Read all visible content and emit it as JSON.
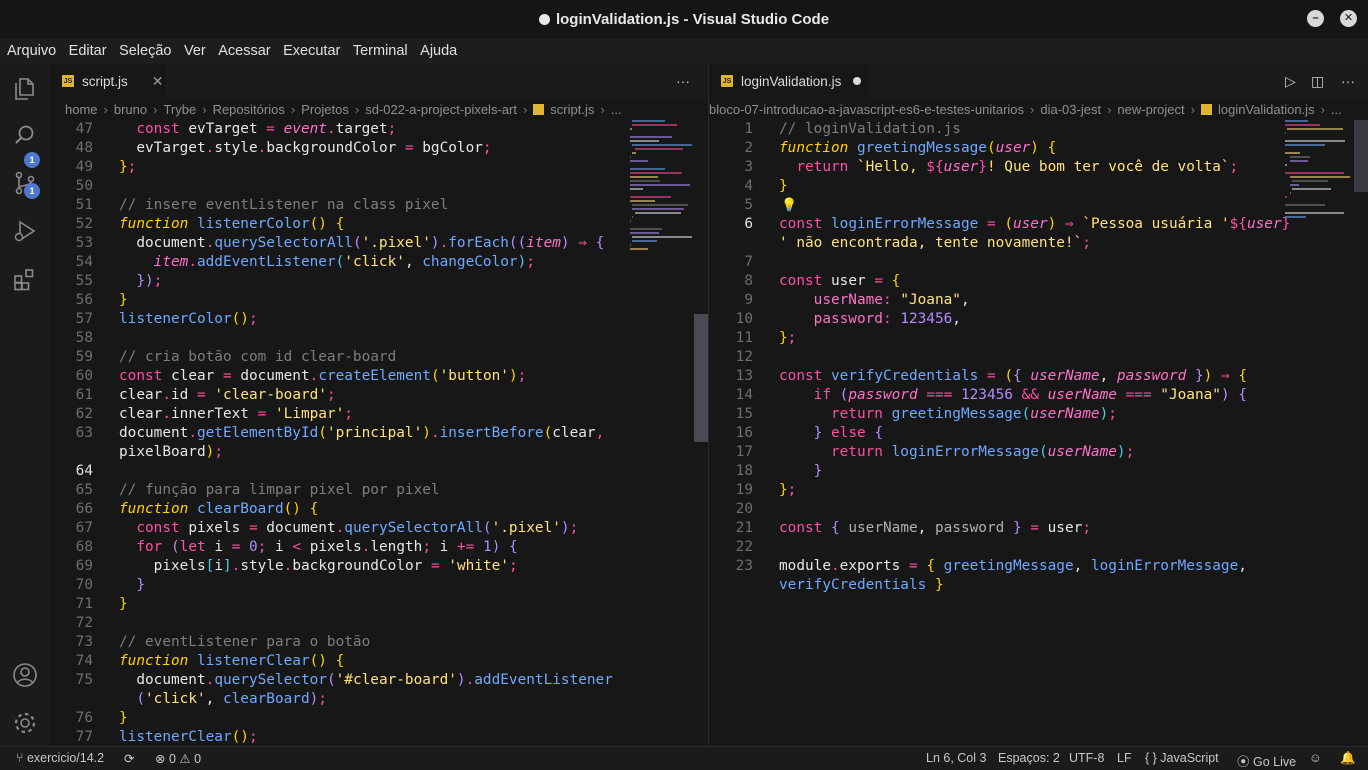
{
  "window": {
    "title": "loginValidation.js - Visual Studio Code"
  },
  "menu": [
    "Arquivo",
    "Editar",
    "Seleção",
    "Ver",
    "Acessar",
    "Executar",
    "Terminal",
    "Ajuda"
  ],
  "activity_bar": {
    "explorer_badge": "1",
    "source_control_badge": "1"
  },
  "left_editor": {
    "tab_label": "script.js",
    "breadcrumb": [
      "home",
      "bruno",
      "Trybe",
      "Repositórios",
      "Projetos",
      "sd-022-a-project-pixels-art",
      "script.js",
      "..."
    ],
    "lines": [
      {
        "n": "47",
        "html": "  <span class='k'>const</span> evTarget <span class='k'>=</span> <span class='i'>event</span><span class='k'>.</span><span class='v'>target</span><span class='k'>;</span>"
      },
      {
        "n": "48",
        "html": "  evTarget<span class='k'>.</span>style<span class='k'>.</span>backgroundColor <span class='k'>=</span> bgColor<span class='k'>;</span>"
      },
      {
        "n": "49",
        "html": "<span class='b'>}</span><span class='k'>;</span>"
      },
      {
        "n": "50",
        "html": ""
      },
      {
        "n": "51",
        "html": "<span class='c'>// insere eventListener na class pixel</span>"
      },
      {
        "n": "52",
        "html": "<span class='i' style='color:#ffd200'>function</span> <span class='f'>listenerColor</span><span class='b'>()</span> <span class='b'>{</span>"
      },
      {
        "n": "53",
        "html": "  document<span class='k'>.</span><span class='f'>querySelectorAll</span><span class='n'>(</span><span class='s'>'.pixel'</span><span class='n'>)</span><span class='k'>.</span><span class='f'>forEach</span><span class='n'>((</span><span class='i'>item</span><span class='n'>)</span> <span class='k'>⇒</span> <span class='n'>{</span>"
      },
      {
        "n": "54",
        "html": "    <span class='i'>item</span><span class='k'>.</span><span class='f'>addEventListener</span><span class='p'>(</span><span class='s'>'click'</span>, <span class='f'>changeColor</span><span class='p'>)</span><span class='k'>;</span>"
      },
      {
        "n": "55",
        "html": "  <span class='n'>})</span><span class='k'>;</span>"
      },
      {
        "n": "56",
        "html": "<span class='b'>}</span>"
      },
      {
        "n": "57",
        "html": "<span class='f'>listenerColor</span><span class='b'>()</span><span class='k'>;</span>"
      },
      {
        "n": "58",
        "html": ""
      },
      {
        "n": "59",
        "html": "<span class='c'>// cria botão com id clear-board</span>"
      },
      {
        "n": "60",
        "html": "<span class='k'>const</span> clear <span class='k'>=</span> document<span class='k'>.</span><span class='f'>createElement</span><span class='b'>(</span><span class='s'>'button'</span><span class='b'>)</span><span class='k'>;</span>"
      },
      {
        "n": "61",
        "html": "clear<span class='k'>.</span>id <span class='k'>=</span> <span class='s'>'clear-board'</span><span class='k'>;</span>"
      },
      {
        "n": "62",
        "html": "clear<span class='k'>.</span>innerText <span class='k'>=</span> <span class='s'>'Limpar'</span><span class='k'>;</span>"
      },
      {
        "n": "63",
        "html": "document<span class='k'>.</span><span class='f'>getElementById</span><span class='b'>(</span><span class='s'>'principal'</span><span class='b'>)</span><span class='k'>.</span><span class='f'>insertBefore</span><span class='b'>(</span>clear<span class='k'>,</span>"
      },
      {
        "n": "",
        "html": "pixelBoard<span class='b'>)</span><span class='k'>;</span>"
      },
      {
        "n": "64",
        "html": "",
        "active": true
      },
      {
        "n": "65",
        "html": "<span class='c'>// função para limpar pixel por pixel</span>"
      },
      {
        "n": "66",
        "html": "<span class='i' style='color:#ffd200'>function</span> <span class='f'>clearBoard</span><span class='b'>()</span> <span class='b'>{</span>"
      },
      {
        "n": "67",
        "html": "  <span class='k'>const</span> pixels <span class='k'>=</span> document<span class='k'>.</span><span class='f'>querySelectorAll</span><span class='n'>(</span><span class='s'>'.pixel'</span><span class='n'>)</span><span class='k'>;</span>"
      },
      {
        "n": "68",
        "html": "  <span class='k'>for</span> <span class='n'>(</span><span class='k'>let</span> i <span class='k'>=</span> <span class='n'>0</span><span class='k'>;</span> i <span class='k'>&lt;</span> pixels<span class='k'>.</span>length<span class='k'>;</span> i <span class='k'>+=</span> <span class='n'>1</span><span class='n'>)</span> <span class='n'>{</span>"
      },
      {
        "n": "69",
        "html": "    pixels<span class='p'>[</span>i<span class='p'>]</span><span class='k'>.</span>style<span class='k'>.</span>backgroundColor <span class='k'>=</span> <span class='s'>'white'</span><span class='k'>;</span>"
      },
      {
        "n": "70",
        "html": "  <span class='n'>}</span>"
      },
      {
        "n": "71",
        "html": "<span class='b'>}</span>"
      },
      {
        "n": "72",
        "html": ""
      },
      {
        "n": "73",
        "html": "<span class='c'>// eventListener para o botão</span>"
      },
      {
        "n": "74",
        "html": "<span class='i' style='color:#ffd200'>function</span> <span class='f'>listenerClear</span><span class='b'>()</span> <span class='b'>{</span>"
      },
      {
        "n": "75",
        "html": "  document<span class='k'>.</span><span class='f'>querySelector</span><span class='n'>(</span><span class='s'>'#clear-board'</span><span class='n'>)</span><span class='k'>.</span><span class='f'>addEventListener</span>"
      },
      {
        "n": "",
        "html": "  <span class='n'>(</span><span class='s'>'click'</span>, <span class='f'>clearBoard</span><span class='n'>)</span><span class='k'>;</span>"
      },
      {
        "n": "76",
        "html": "<span class='b'>}</span>"
      },
      {
        "n": "77",
        "html": "<span class='f'>listenerClear</span><span class='b'>()</span><span class='k'>;</span>"
      }
    ]
  },
  "right_editor": {
    "tab_label": "loginValidation.js",
    "breadcrumb": [
      "bloco-07-introducao-a-javascript-es6-e-testes-unitarios",
      "dia-03-jest",
      "new-project",
      "loginValidation.js",
      "..."
    ],
    "lines": [
      {
        "n": "1",
        "html": "<span class='c'>// loginValidation.js</span>"
      },
      {
        "n": "2",
        "html": "<span class='i' style='color:#ffd200'>function</span> <span class='f'>greetingMessage</span><span class='b'>(</span><span class='i'>user</span><span class='b'>)</span> <span class='b'>{</span>"
      },
      {
        "n": "3",
        "html": "  <span class='k'>return</span> <span class='s'>`Hello, </span><span class='k'>${</span><span class='i'>user</span><span class='k'>}</span><span class='s'>! Que bom ter você de volta`</span><span class='k'>;</span>"
      },
      {
        "n": "4",
        "html": "<span class='b'>}</span>"
      },
      {
        "n": "5",
        "html": ""
      },
      {
        "n": "6",
        "html": "<span class='k'>const</span> <span class='f'>loginErrorMessage</span> <span class='k'>=</span> <span class='b'>(</span><span class='i'>user</span><span class='b'>)</span> <span class='k'>⇒</span> <span class='s'>`Pessoa usuária '</span><span class='k'>${</span><span class='i'>user</span><span class='k'>}</span>",
        "active": true
      },
      {
        "n": "",
        "html": "<span class='s'>' não encontrada, tente novamente!`</span><span class='k'>;</span>"
      },
      {
        "n": "7",
        "html": ""
      },
      {
        "n": "8",
        "html": "<span class='k'>const</span> user <span class='k'>=</span> <span class='b'>{</span>"
      },
      {
        "n": "9",
        "html": "    <span class='i' style='font-style:normal'>userName</span><span class='k'>:</span> <span class='s'>\"Joana\"</span>,"
      },
      {
        "n": "10",
        "html": "    <span class='i' style='font-style:normal'>password</span><span class='k'>:</span> <span class='n'>123456</span>,"
      },
      {
        "n": "11",
        "html": "<span class='b'>}</span><span class='k'>;</span>"
      },
      {
        "n": "12",
        "html": ""
      },
      {
        "n": "13",
        "html": "<span class='k'>const</span> <span class='f'>verifyCredentials</span> <span class='k'>=</span> <span class='b'>(</span><span class='n'>{</span> <span class='i'>userName</span>, <span class='i'>password</span> <span class='n'>}</span><span class='b'>)</span> <span class='k'>⇒</span> <span class='b'>{</span>"
      },
      {
        "n": "14",
        "html": "    <span class='k'>if</span> <span class='n'>(</span><span class='i'>password</span> <span class='k'>===</span> <span class='n'>123456</span> <span class='k'>&amp;&amp;</span> <span class='i'>userName</span> <span class='k'>===</span> <span class='s'>\"Joana\"</span><span class='n'>)</span> <span class='n'>{</span>"
      },
      {
        "n": "15",
        "html": "      <span class='k'>return</span> <span class='f'>greetingMessage</span><span class='p'>(</span><span class='i'>userName</span><span class='p'>)</span><span class='k'>;</span>"
      },
      {
        "n": "16",
        "html": "    <span class='n'>}</span> <span class='k'>else</span> <span class='n'>{</span>"
      },
      {
        "n": "17",
        "html": "      <span class='k'>return</span> <span class='f'>loginErrorMessage</span><span class='p'>(</span><span class='i'>userName</span><span class='p'>)</span><span class='k'>;</span>"
      },
      {
        "n": "18",
        "html": "    <span class='n'>}</span>"
      },
      {
        "n": "19",
        "html": "<span class='b'>}</span><span class='k'>;</span>"
      },
      {
        "n": "20",
        "html": ""
      },
      {
        "n": "21",
        "html": "<span class='k'>const</span> <span class='n'>{</span> <span class='i' style='font-style:normal;color:#b0b0b0'>userName</span>, <span class='i' style='font-style:normal;color:#b0b0b0'>password</span> <span class='n'>}</span> <span class='k'>=</span> user<span class='k'>;</span>"
      },
      {
        "n": "22",
        "html": ""
      },
      {
        "n": "23",
        "html": "module<span class='k'>.</span>exports <span class='k'>=</span> <span class='b'>{</span> <span class='f'>greetingMessage</span>, <span class='f'>loginErrorMessage</span>,"
      },
      {
        "n": "",
        "html": "<span class='f'>verifyCredentials</span> <span class='b'>}</span>"
      }
    ]
  },
  "status_bar": {
    "branch": "exercicio/14.2",
    "errors": "0",
    "warnings": "0",
    "cursor": "Ln 6, Col 3",
    "spaces": "Espaços: 2",
    "encoding": "UTF-8",
    "eol": "LF",
    "language": "JavaScript",
    "golive": "Go Live"
  }
}
